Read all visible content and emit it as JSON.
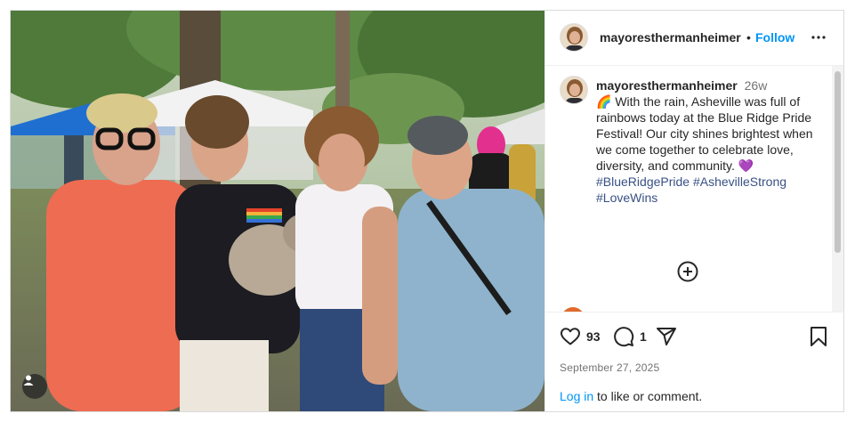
{
  "post": {
    "username": "mayoresthermanheimer",
    "separator": "•",
    "follow_label": "Follow",
    "more_icon": "more-horizontal-icon",
    "caption": {
      "username": "mayoresthermanheimer",
      "age": "26w",
      "emoji_start": "🌈",
      "text": "With the rain, Asheville was full of rainbows today at the Blue Ridge Pride Festival! Our city shines brightest when we come together to celebrate love, diversity, and community.",
      "emoji_end": "💜",
      "hashtags": "#BlueRidgePride #AshevilleStrong #LoveWins"
    },
    "likes_count": "93",
    "comments_count": "1",
    "date": "September 27, 2025",
    "login_link": "Log in",
    "login_rest": " to like or comment."
  },
  "colors": {
    "link_blue": "#0095f6",
    "hashtag_blue": "#385185",
    "muted_text": "#737373",
    "border": "#dbdbdb"
  },
  "photo": {
    "description_icon": "user-tag-icon"
  }
}
